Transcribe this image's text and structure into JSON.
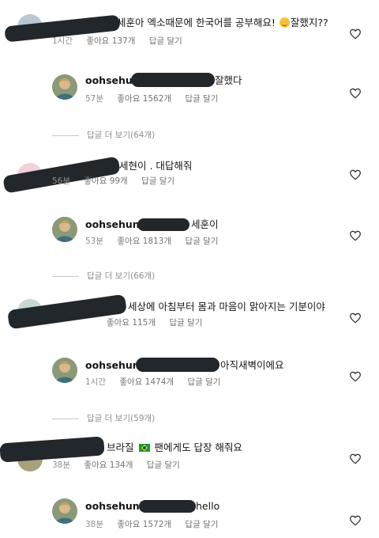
{
  "comments": [
    {
      "text": "세훈아 엑소때문에 한국어를 공부해요!",
      "text_tail": "잘했지??",
      "time": "1시간",
      "likes": "좋아요 137개",
      "reply": "답글 달기"
    },
    {
      "author": "oohsehun",
      "text": "잘했다",
      "time": "57분",
      "likes": "좋아요 1562개",
      "reply": "답글 달기"
    },
    {
      "more": "답글 더 보기(64개)"
    },
    {
      "text": "세현이 . 대답해줘",
      "time": "56분",
      "likes": "좋아요 99개",
      "reply": "답글 달기"
    },
    {
      "author": "oohsehun",
      "text": "세훈이",
      "time": "53분",
      "likes": "좋아요 1813개",
      "reply": "답글 달기"
    },
    {
      "more": "답글 더 보기(66개)"
    },
    {
      "text": "세상에 아침부터 몸과 마음이 맑아지는 기분이야",
      "likes": "좋아요 115개",
      "reply": "답글 달기"
    },
    {
      "author": "oohsehun",
      "text": "아직새벽이에요",
      "time": "1시간",
      "likes": "좋아요 1474개",
      "reply": "답글 달기"
    },
    {
      "more": "답글 더 보기(59개)"
    },
    {
      "text_head": "브라질",
      "text": "팬에게도 답장 해줘요",
      "time": "38분",
      "likes": "좋아요 134개",
      "reply": "답글 달기"
    },
    {
      "author": "oohsehun",
      "text": "hello",
      "time": "38분",
      "likes": "좋아요 1572개",
      "reply": "답글 달기"
    }
  ],
  "icons": {
    "like": "heart-outline-icon",
    "flag": "brazil-flag-emoji",
    "smiley": "grinning-face-emoji"
  },
  "colors": {
    "meta_text": "#8e8e8e",
    "redaction": "#22272c"
  }
}
